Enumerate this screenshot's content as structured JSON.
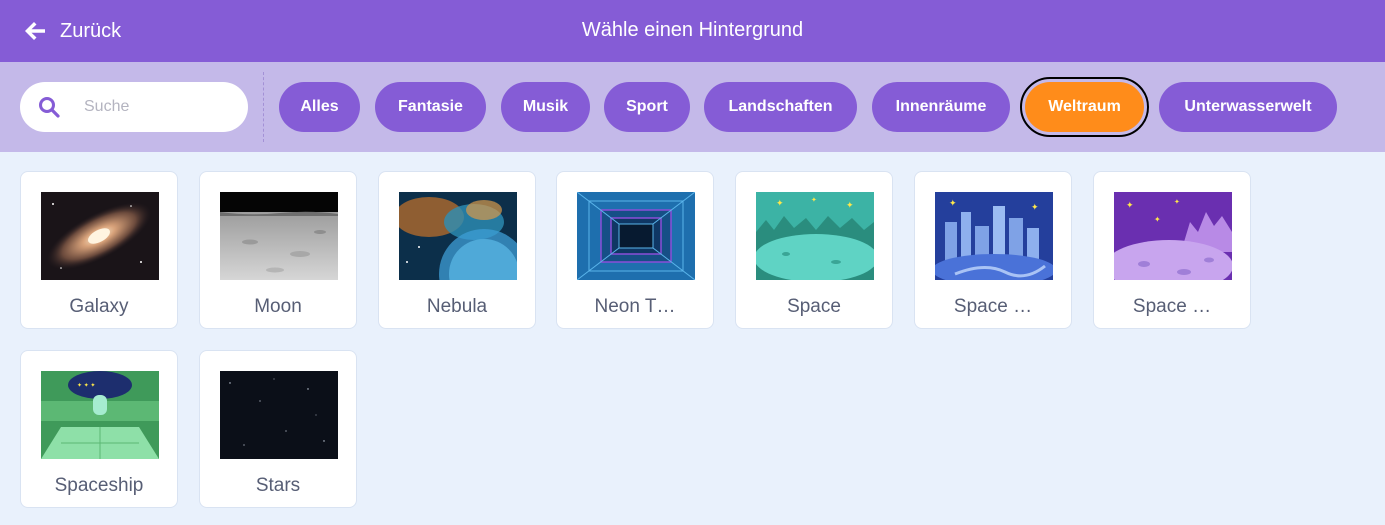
{
  "header": {
    "back_label": "Zurück",
    "title": "Wähle einen Hintergrund"
  },
  "search": {
    "placeholder": "Suche",
    "value": ""
  },
  "categories": [
    {
      "label": "Alles",
      "active": false
    },
    {
      "label": "Fantasie",
      "active": false
    },
    {
      "label": "Musik",
      "active": false
    },
    {
      "label": "Sport",
      "active": false
    },
    {
      "label": "Landschaften",
      "active": false
    },
    {
      "label": "Innenräume",
      "active": false
    },
    {
      "label": "Weltraum",
      "active": true
    },
    {
      "label": "Unterwasserwelt",
      "active": false
    }
  ],
  "backdrops": [
    {
      "name": "Galaxy"
    },
    {
      "name": "Moon"
    },
    {
      "name": "Nebula"
    },
    {
      "name": "Neon T…"
    },
    {
      "name": "Space"
    },
    {
      "name": "Space …"
    },
    {
      "name": "Space …"
    },
    {
      "name": "Spaceship"
    },
    {
      "name": "Stars"
    }
  ],
  "colors": {
    "header_bg": "#855cd6",
    "filter_bar_bg": "#c4b9e9",
    "tag_bg": "#855cd6",
    "tag_active_bg": "#ff8c1a",
    "page_bg": "#e9f1fc",
    "card_text": "#575e75"
  }
}
